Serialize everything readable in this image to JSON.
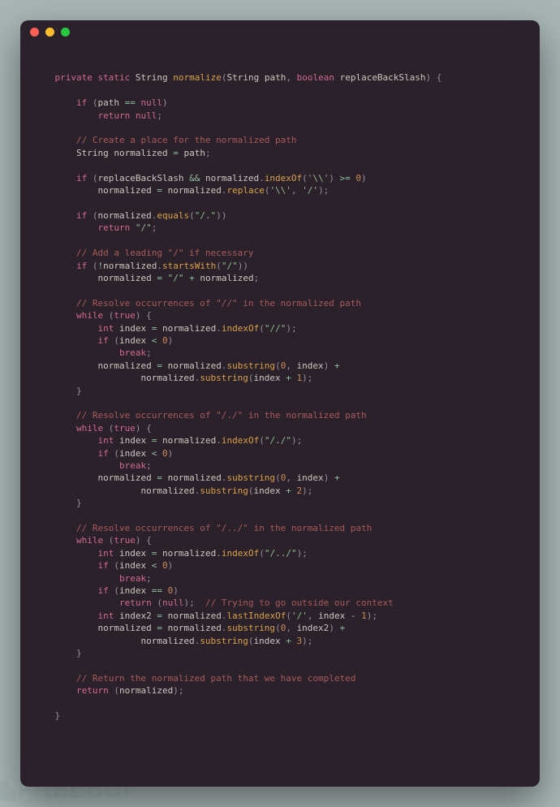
{
  "window": {
    "traffic_lights": [
      "red",
      "yellow",
      "green"
    ]
  },
  "watermark": "FREEBUF",
  "colors": {
    "bg_page": "#a9b5b5",
    "bg_window": "#2b212b",
    "keyword": "#d16a8f",
    "function": "#d9a24a",
    "string": "#8fbf8f",
    "number": "#c98a5a",
    "comment": "#a85b5b",
    "operator": "#8fbf9f",
    "punct": "#9a8f99",
    "text": "#cfc6c0"
  },
  "code_tokens": [
    [
      [
        "pun",
        ""
      ]
    ],
    [
      [
        "pun",
        "    "
      ],
      [
        "kw",
        "private"
      ],
      [
        "pun",
        " "
      ],
      [
        "kw",
        "static"
      ],
      [
        "pun",
        " "
      ],
      [
        "type",
        "String"
      ],
      [
        "pun",
        " "
      ],
      [
        "fn",
        "normalize"
      ],
      [
        "pun",
        "("
      ],
      [
        "type",
        "String"
      ],
      [
        "pun",
        " "
      ],
      [
        "id",
        "path"
      ],
      [
        "pun",
        ", "
      ],
      [
        "kw",
        "boolean"
      ],
      [
        "pun",
        " "
      ],
      [
        "id",
        "replaceBackSlash"
      ],
      [
        "pun",
        ") {"
      ]
    ],
    [
      [
        "pun",
        ""
      ]
    ],
    [
      [
        "pun",
        "        "
      ],
      [
        "kw",
        "if"
      ],
      [
        "pun",
        " ("
      ],
      [
        "id",
        "path"
      ],
      [
        "pun",
        " "
      ],
      [
        "op",
        "=="
      ],
      [
        "pun",
        " "
      ],
      [
        "kw",
        "null"
      ],
      [
        "pun",
        ")"
      ]
    ],
    [
      [
        "pun",
        "            "
      ],
      [
        "kw",
        "return"
      ],
      [
        "pun",
        " "
      ],
      [
        "kw",
        "null"
      ],
      [
        "pun",
        ";"
      ]
    ],
    [
      [
        "pun",
        ""
      ]
    ],
    [
      [
        "pun",
        "        "
      ],
      [
        "cmt",
        "// Create a place for the normalized path"
      ]
    ],
    [
      [
        "pun",
        "        "
      ],
      [
        "type",
        "String"
      ],
      [
        "pun",
        " "
      ],
      [
        "id",
        "normalized"
      ],
      [
        "pun",
        " "
      ],
      [
        "op",
        "="
      ],
      [
        "pun",
        " "
      ],
      [
        "id",
        "path"
      ],
      [
        "pun",
        ";"
      ]
    ],
    [
      [
        "pun",
        ""
      ]
    ],
    [
      [
        "pun",
        "        "
      ],
      [
        "kw",
        "if"
      ],
      [
        "pun",
        " ("
      ],
      [
        "id",
        "replaceBackSlash"
      ],
      [
        "pun",
        " "
      ],
      [
        "op",
        "&&"
      ],
      [
        "pun",
        " "
      ],
      [
        "id",
        "normalized"
      ],
      [
        "pun",
        "."
      ],
      [
        "fn",
        "indexOf"
      ],
      [
        "pun",
        "("
      ],
      [
        "str",
        "'\\\\'"
      ],
      [
        "pun",
        ") "
      ],
      [
        "op",
        ">="
      ],
      [
        "pun",
        " "
      ],
      [
        "num",
        "0"
      ],
      [
        "pun",
        ")"
      ]
    ],
    [
      [
        "pun",
        "            "
      ],
      [
        "id",
        "normalized"
      ],
      [
        "pun",
        " "
      ],
      [
        "op",
        "="
      ],
      [
        "pun",
        " "
      ],
      [
        "id",
        "normalized"
      ],
      [
        "pun",
        "."
      ],
      [
        "fn",
        "replace"
      ],
      [
        "pun",
        "("
      ],
      [
        "str",
        "'\\\\'"
      ],
      [
        "pun",
        ", "
      ],
      [
        "str",
        "'/'"
      ],
      [
        "pun",
        ");"
      ]
    ],
    [
      [
        "pun",
        ""
      ]
    ],
    [
      [
        "pun",
        "        "
      ],
      [
        "kw",
        "if"
      ],
      [
        "pun",
        " ("
      ],
      [
        "id",
        "normalized"
      ],
      [
        "pun",
        "."
      ],
      [
        "fn",
        "equals"
      ],
      [
        "pun",
        "("
      ],
      [
        "str",
        "\"/.\""
      ],
      [
        "pun",
        "))"
      ]
    ],
    [
      [
        "pun",
        "            "
      ],
      [
        "kw",
        "return"
      ],
      [
        "pun",
        " "
      ],
      [
        "str",
        "\"/\""
      ],
      [
        "pun",
        ";"
      ]
    ],
    [
      [
        "pun",
        ""
      ]
    ],
    [
      [
        "pun",
        "        "
      ],
      [
        "cmt",
        "// Add a leading \"/\" if necessary"
      ]
    ],
    [
      [
        "pun",
        "        "
      ],
      [
        "kw",
        "if"
      ],
      [
        "pun",
        " ("
      ],
      [
        "op",
        "!"
      ],
      [
        "id",
        "normalized"
      ],
      [
        "pun",
        "."
      ],
      [
        "fn",
        "startsWith"
      ],
      [
        "pun",
        "("
      ],
      [
        "str",
        "\"/\""
      ],
      [
        "pun",
        "))"
      ]
    ],
    [
      [
        "pun",
        "            "
      ],
      [
        "id",
        "normalized"
      ],
      [
        "pun",
        " "
      ],
      [
        "op",
        "="
      ],
      [
        "pun",
        " "
      ],
      [
        "str",
        "\"/\""
      ],
      [
        "pun",
        " "
      ],
      [
        "op",
        "+"
      ],
      [
        "pun",
        " "
      ],
      [
        "id",
        "normalized"
      ],
      [
        "pun",
        ";"
      ]
    ],
    [
      [
        "pun",
        ""
      ]
    ],
    [
      [
        "pun",
        "        "
      ],
      [
        "cmt",
        "// Resolve occurrences of \"//\" in the normalized path"
      ]
    ],
    [
      [
        "pun",
        "        "
      ],
      [
        "kw",
        "while"
      ],
      [
        "pun",
        " ("
      ],
      [
        "kw",
        "true"
      ],
      [
        "pun",
        ") {"
      ]
    ],
    [
      [
        "pun",
        "            "
      ],
      [
        "kw",
        "int"
      ],
      [
        "pun",
        " "
      ],
      [
        "id",
        "index"
      ],
      [
        "pun",
        " "
      ],
      [
        "op",
        "="
      ],
      [
        "pun",
        " "
      ],
      [
        "id",
        "normalized"
      ],
      [
        "pun",
        "."
      ],
      [
        "fn",
        "indexOf"
      ],
      [
        "pun",
        "("
      ],
      [
        "str",
        "\"//\""
      ],
      [
        "pun",
        ");"
      ]
    ],
    [
      [
        "pun",
        "            "
      ],
      [
        "kw",
        "if"
      ],
      [
        "pun",
        " ("
      ],
      [
        "id",
        "index"
      ],
      [
        "pun",
        " "
      ],
      [
        "op",
        "<"
      ],
      [
        "pun",
        " "
      ],
      [
        "num",
        "0"
      ],
      [
        "pun",
        ")"
      ]
    ],
    [
      [
        "pun",
        "                "
      ],
      [
        "kw",
        "break"
      ],
      [
        "pun",
        ";"
      ]
    ],
    [
      [
        "pun",
        "            "
      ],
      [
        "id",
        "normalized"
      ],
      [
        "pun",
        " "
      ],
      [
        "op",
        "="
      ],
      [
        "pun",
        " "
      ],
      [
        "id",
        "normalized"
      ],
      [
        "pun",
        "."
      ],
      [
        "fn",
        "substring"
      ],
      [
        "pun",
        "("
      ],
      [
        "num",
        "0"
      ],
      [
        "pun",
        ", "
      ],
      [
        "id",
        "index"
      ],
      [
        "pun",
        ") "
      ],
      [
        "op",
        "+"
      ]
    ],
    [
      [
        "pun",
        "                    "
      ],
      [
        "id",
        "normalized"
      ],
      [
        "pun",
        "."
      ],
      [
        "fn",
        "substring"
      ],
      [
        "pun",
        "("
      ],
      [
        "id",
        "index"
      ],
      [
        "pun",
        " "
      ],
      [
        "op",
        "+"
      ],
      [
        "pun",
        " "
      ],
      [
        "num",
        "1"
      ],
      [
        "pun",
        ");"
      ]
    ],
    [
      [
        "pun",
        "        }"
      ]
    ],
    [
      [
        "pun",
        ""
      ]
    ],
    [
      [
        "pun",
        "        "
      ],
      [
        "cmt",
        "// Resolve occurrences of \"/./\" in the normalized path"
      ]
    ],
    [
      [
        "pun",
        "        "
      ],
      [
        "kw",
        "while"
      ],
      [
        "pun",
        " ("
      ],
      [
        "kw",
        "true"
      ],
      [
        "pun",
        ") {"
      ]
    ],
    [
      [
        "pun",
        "            "
      ],
      [
        "kw",
        "int"
      ],
      [
        "pun",
        " "
      ],
      [
        "id",
        "index"
      ],
      [
        "pun",
        " "
      ],
      [
        "op",
        "="
      ],
      [
        "pun",
        " "
      ],
      [
        "id",
        "normalized"
      ],
      [
        "pun",
        "."
      ],
      [
        "fn",
        "indexOf"
      ],
      [
        "pun",
        "("
      ],
      [
        "str",
        "\"/./\""
      ],
      [
        "pun",
        ");"
      ]
    ],
    [
      [
        "pun",
        "            "
      ],
      [
        "kw",
        "if"
      ],
      [
        "pun",
        " ("
      ],
      [
        "id",
        "index"
      ],
      [
        "pun",
        " "
      ],
      [
        "op",
        "<"
      ],
      [
        "pun",
        " "
      ],
      [
        "num",
        "0"
      ],
      [
        "pun",
        ")"
      ]
    ],
    [
      [
        "pun",
        "                "
      ],
      [
        "kw",
        "break"
      ],
      [
        "pun",
        ";"
      ]
    ],
    [
      [
        "pun",
        "            "
      ],
      [
        "id",
        "normalized"
      ],
      [
        "pun",
        " "
      ],
      [
        "op",
        "="
      ],
      [
        "pun",
        " "
      ],
      [
        "id",
        "normalized"
      ],
      [
        "pun",
        "."
      ],
      [
        "fn",
        "substring"
      ],
      [
        "pun",
        "("
      ],
      [
        "num",
        "0"
      ],
      [
        "pun",
        ", "
      ],
      [
        "id",
        "index"
      ],
      [
        "pun",
        ") "
      ],
      [
        "op",
        "+"
      ]
    ],
    [
      [
        "pun",
        "                    "
      ],
      [
        "id",
        "normalized"
      ],
      [
        "pun",
        "."
      ],
      [
        "fn",
        "substring"
      ],
      [
        "pun",
        "("
      ],
      [
        "id",
        "index"
      ],
      [
        "pun",
        " "
      ],
      [
        "op",
        "+"
      ],
      [
        "pun",
        " "
      ],
      [
        "num",
        "2"
      ],
      [
        "pun",
        ");"
      ]
    ],
    [
      [
        "pun",
        "        }"
      ]
    ],
    [
      [
        "pun",
        ""
      ]
    ],
    [
      [
        "pun",
        "        "
      ],
      [
        "cmt",
        "// Resolve occurrences of \"/../\" in the normalized path"
      ]
    ],
    [
      [
        "pun",
        "        "
      ],
      [
        "kw",
        "while"
      ],
      [
        "pun",
        " ("
      ],
      [
        "kw",
        "true"
      ],
      [
        "pun",
        ") {"
      ]
    ],
    [
      [
        "pun",
        "            "
      ],
      [
        "kw",
        "int"
      ],
      [
        "pun",
        " "
      ],
      [
        "id",
        "index"
      ],
      [
        "pun",
        " "
      ],
      [
        "op",
        "="
      ],
      [
        "pun",
        " "
      ],
      [
        "id",
        "normalized"
      ],
      [
        "pun",
        "."
      ],
      [
        "fn",
        "indexOf"
      ],
      [
        "pun",
        "("
      ],
      [
        "str",
        "\"/../\""
      ],
      [
        "pun",
        ");"
      ]
    ],
    [
      [
        "pun",
        "            "
      ],
      [
        "kw",
        "if"
      ],
      [
        "pun",
        " ("
      ],
      [
        "id",
        "index"
      ],
      [
        "pun",
        " "
      ],
      [
        "op",
        "<"
      ],
      [
        "pun",
        " "
      ],
      [
        "num",
        "0"
      ],
      [
        "pun",
        ")"
      ]
    ],
    [
      [
        "pun",
        "                "
      ],
      [
        "kw",
        "break"
      ],
      [
        "pun",
        ";"
      ]
    ],
    [
      [
        "pun",
        "            "
      ],
      [
        "kw",
        "if"
      ],
      [
        "pun",
        " ("
      ],
      [
        "id",
        "index"
      ],
      [
        "pun",
        " "
      ],
      [
        "op",
        "=="
      ],
      [
        "pun",
        " "
      ],
      [
        "num",
        "0"
      ],
      [
        "pun",
        ")"
      ]
    ],
    [
      [
        "pun",
        "                "
      ],
      [
        "kw",
        "return"
      ],
      [
        "pun",
        " ("
      ],
      [
        "kw",
        "null"
      ],
      [
        "pun",
        ");  "
      ],
      [
        "cmt",
        "// Trying to go outside our context"
      ]
    ],
    [
      [
        "pun",
        "            "
      ],
      [
        "kw",
        "int"
      ],
      [
        "pun",
        " "
      ],
      [
        "id",
        "index2"
      ],
      [
        "pun",
        " "
      ],
      [
        "op",
        "="
      ],
      [
        "pun",
        " "
      ],
      [
        "id",
        "normalized"
      ],
      [
        "pun",
        "."
      ],
      [
        "fn",
        "lastIndexOf"
      ],
      [
        "pun",
        "("
      ],
      [
        "str",
        "'/'"
      ],
      [
        "pun",
        ", "
      ],
      [
        "id",
        "index"
      ],
      [
        "pun",
        " "
      ],
      [
        "op",
        "-"
      ],
      [
        "pun",
        " "
      ],
      [
        "num",
        "1"
      ],
      [
        "pun",
        ");"
      ]
    ],
    [
      [
        "pun",
        "            "
      ],
      [
        "id",
        "normalized"
      ],
      [
        "pun",
        " "
      ],
      [
        "op",
        "="
      ],
      [
        "pun",
        " "
      ],
      [
        "id",
        "normalized"
      ],
      [
        "pun",
        "."
      ],
      [
        "fn",
        "substring"
      ],
      [
        "pun",
        "("
      ],
      [
        "num",
        "0"
      ],
      [
        "pun",
        ", "
      ],
      [
        "id",
        "index2"
      ],
      [
        "pun",
        ") "
      ],
      [
        "op",
        "+"
      ]
    ],
    [
      [
        "pun",
        "                    "
      ],
      [
        "id",
        "normalized"
      ],
      [
        "pun",
        "."
      ],
      [
        "fn",
        "substring"
      ],
      [
        "pun",
        "("
      ],
      [
        "id",
        "index"
      ],
      [
        "pun",
        " "
      ],
      [
        "op",
        "+"
      ],
      [
        "pun",
        " "
      ],
      [
        "num",
        "3"
      ],
      [
        "pun",
        ");"
      ]
    ],
    [
      [
        "pun",
        "        }"
      ]
    ],
    [
      [
        "pun",
        ""
      ]
    ],
    [
      [
        "pun",
        "        "
      ],
      [
        "cmt",
        "// Return the normalized path that we have completed"
      ]
    ],
    [
      [
        "pun",
        "        "
      ],
      [
        "kw",
        "return"
      ],
      [
        "pun",
        " ("
      ],
      [
        "id",
        "normalized"
      ],
      [
        "pun",
        ");"
      ]
    ],
    [
      [
        "pun",
        ""
      ]
    ],
    [
      [
        "pun",
        "    }"
      ]
    ]
  ]
}
